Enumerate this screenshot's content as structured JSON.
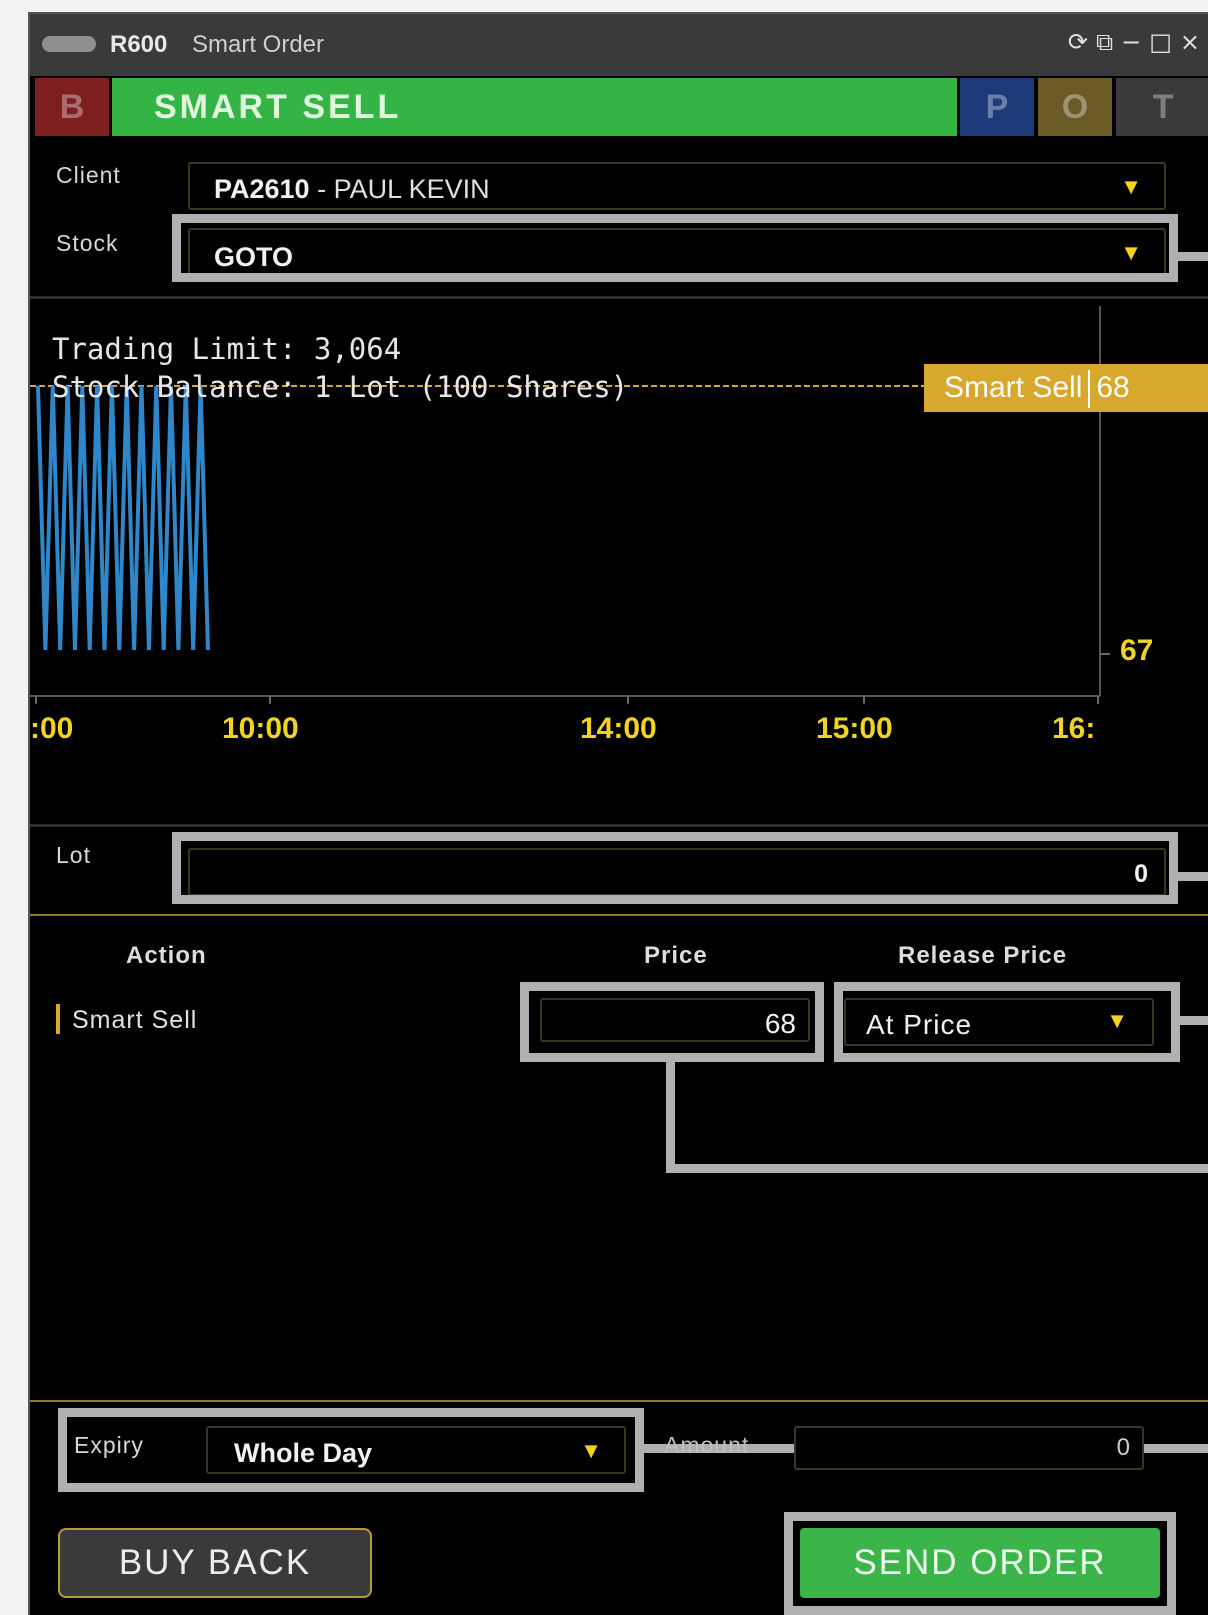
{
  "window": {
    "app_code": "R600",
    "title": "Smart Order",
    "controls": [
      "refresh-icon",
      "popout-icon",
      "minimize-icon",
      "maximize-icon",
      "close-icon"
    ]
  },
  "tabs": {
    "buy": "B",
    "active": "SMART SELL",
    "p": "P",
    "o": "O",
    "t": "T"
  },
  "form": {
    "client_label": "Client",
    "client_code": "PA2610",
    "client_name": " - PAUL KEVIN",
    "stock_label": "Stock",
    "stock_value": "GOTO"
  },
  "chart_data": {
    "type": "line",
    "info_lines": [
      "Trading Limit: 3,064",
      "Stock Balance: 1 Lot (100 Shares)"
    ],
    "x_ticks": [
      ":00",
      "10:00",
      "14:00",
      "15:00",
      "16:"
    ],
    "y_ticks": [
      67
    ],
    "reference_line": {
      "label": "Smart Sell",
      "value": 68
    },
    "series": [
      {
        "values": [
          68,
          67,
          68,
          67,
          68,
          67,
          68,
          67,
          68,
          67,
          68,
          67,
          68,
          67,
          68,
          67,
          68,
          67,
          68,
          67,
          68,
          67,
          68,
          67
        ]
      }
    ],
    "colors": {
      "series": "#2f86c9",
      "reference": "#d7a82d",
      "ticks": "#f1d321"
    }
  },
  "lot": {
    "label": "Lot",
    "value": "0"
  },
  "table": {
    "headers": {
      "action": "Action",
      "price": "Price",
      "release": "Release Price"
    },
    "row": {
      "action": "Smart Sell",
      "price": "68",
      "release": "At Price"
    }
  },
  "footer": {
    "expiry_label": "Expiry",
    "expiry_value": "Whole Day",
    "amount_label": "Amount",
    "amount_value": "0",
    "buy_back": "BUY BACK",
    "send_order": "SEND ORDER"
  },
  "colors": {
    "sell_green": "#35b446",
    "accent_yellow": "#f1d321",
    "gold": "#d7a82d",
    "border_gold": "#4a4021"
  }
}
